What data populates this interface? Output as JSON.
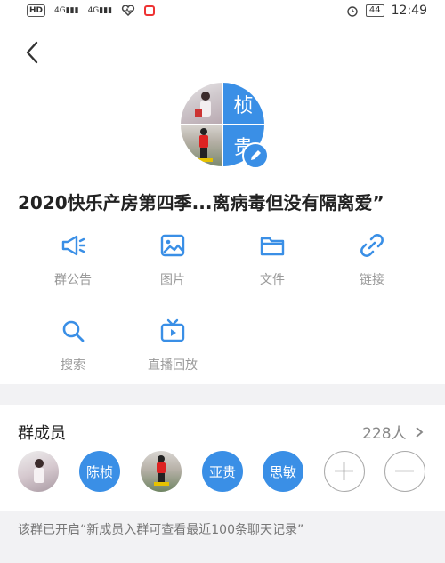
{
  "status_bar": {
    "hd": "HD",
    "signal1": "4G",
    "signal2": "4G",
    "battery": "44",
    "time": "12:49"
  },
  "group": {
    "avatar_chars": [
      "桢",
      "贵"
    ],
    "title": "2020快乐产房第四季...离病毒但没有隔离爱”"
  },
  "actions": [
    {
      "label": "群公告",
      "icon": "megaphone-icon"
    },
    {
      "label": "图片",
      "icon": "image-icon"
    },
    {
      "label": "文件",
      "icon": "folder-icon"
    },
    {
      "label": "链接",
      "icon": "link-icon"
    },
    {
      "label": "搜索",
      "icon": "search-icon"
    },
    {
      "label": "直播回放",
      "icon": "tv-icon"
    }
  ],
  "members_section": {
    "title": "群成员",
    "count": "228人",
    "members": [
      {
        "type": "photo"
      },
      {
        "type": "text",
        "name": "陈桢"
      },
      {
        "type": "photo"
      },
      {
        "type": "text",
        "name": "亚贵"
      },
      {
        "type": "text",
        "name": "思敏"
      }
    ]
  },
  "footer_note": "该群已开启“新成员入群可查看最近100条聊天记录”",
  "colors": {
    "accent": "#3a8fe6",
    "muted_text": "#999999",
    "background": "#f2f2f4"
  }
}
